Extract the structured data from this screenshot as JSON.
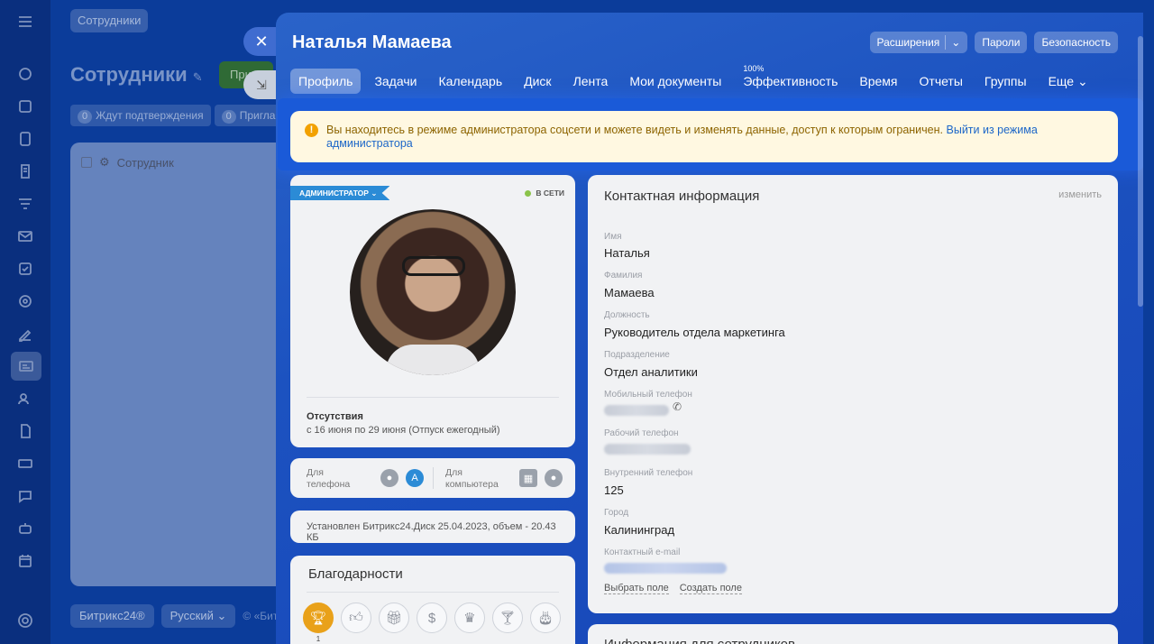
{
  "background": {
    "breadcrumb": "Сотрудники",
    "title": "Сотрудники",
    "primary_button_label": "При",
    "filters": [
      {
        "count": "0",
        "label": "Ждут подтверждения"
      },
      {
        "count": "0",
        "label": "Приглаше"
      }
    ],
    "table_header": "Сотрудник",
    "footer": {
      "brand": "Битрикс24",
      "language": "Русский",
      "copyright": "© «Битр"
    }
  },
  "profile": {
    "name": "Наталья Мамаева",
    "actions": {
      "extensions": "Расширения",
      "passwords": "Пароли",
      "security": "Безопасность"
    },
    "tabs": [
      {
        "label": "Профиль"
      },
      {
        "label": "Задачи"
      },
      {
        "label": "Календарь"
      },
      {
        "label": "Диск"
      },
      {
        "label": "Лента"
      },
      {
        "label": "Мои документы"
      },
      {
        "label": "Эффективность",
        "sup": "100%"
      },
      {
        "label": "Время"
      },
      {
        "label": "Отчеты"
      },
      {
        "label": "Группы"
      },
      {
        "label": "Еще"
      }
    ],
    "notice": {
      "text": "Вы находитесь в режиме администратора соцсети и можете видеть и изменять данные, доступ к которым ограничен.",
      "link": "Выйти из режима администратора"
    },
    "card": {
      "role_tag": "АДМИНИСТРАТОР",
      "status": "В СЕТИ",
      "absence_title": "Отсутствия",
      "absence_text": "с 16 июня по 29 июня (Отпуск ежегодный)"
    },
    "apps": {
      "phone_label_1": "Для",
      "phone_label_2": "телефона",
      "pc_label_1": "Для",
      "pc_label_2": "компьютера"
    },
    "disk_info": "Установлен Битрикс24.Диск 25.04.2023, объем - 20.43 КБ",
    "thanks": {
      "title": "Благодарности",
      "first_count": "1"
    },
    "contact": {
      "title": "Контактная информация",
      "edit": "изменить",
      "fields": {
        "first_name_label": "Имя",
        "first_name": "Наталья",
        "last_name_label": "Фамилия",
        "last_name": "Мамаева",
        "position_label": "Должность",
        "position": "Руководитель отдела маркетинга",
        "department_label": "Подразделение",
        "department": "Отдел аналитики",
        "mobile_label": "Мобильный телефон",
        "work_phone_label": "Рабочий телефон",
        "internal_phone_label": "Внутренний телефон",
        "internal_phone": "125",
        "city_label": "Город",
        "city": "Калининград",
        "email_label": "Контактный e-mail"
      },
      "select_field": "Выбрать поле",
      "create_field": "Создать поле"
    },
    "extra_title": "Информация для сотрудников"
  },
  "colors": {
    "accent_blue": "#1c52c0",
    "notice_bg": "#fff8e1",
    "notice_text": "#8d6400",
    "online": "#8bc34a",
    "admin_tag": "#2b8bd6"
  }
}
